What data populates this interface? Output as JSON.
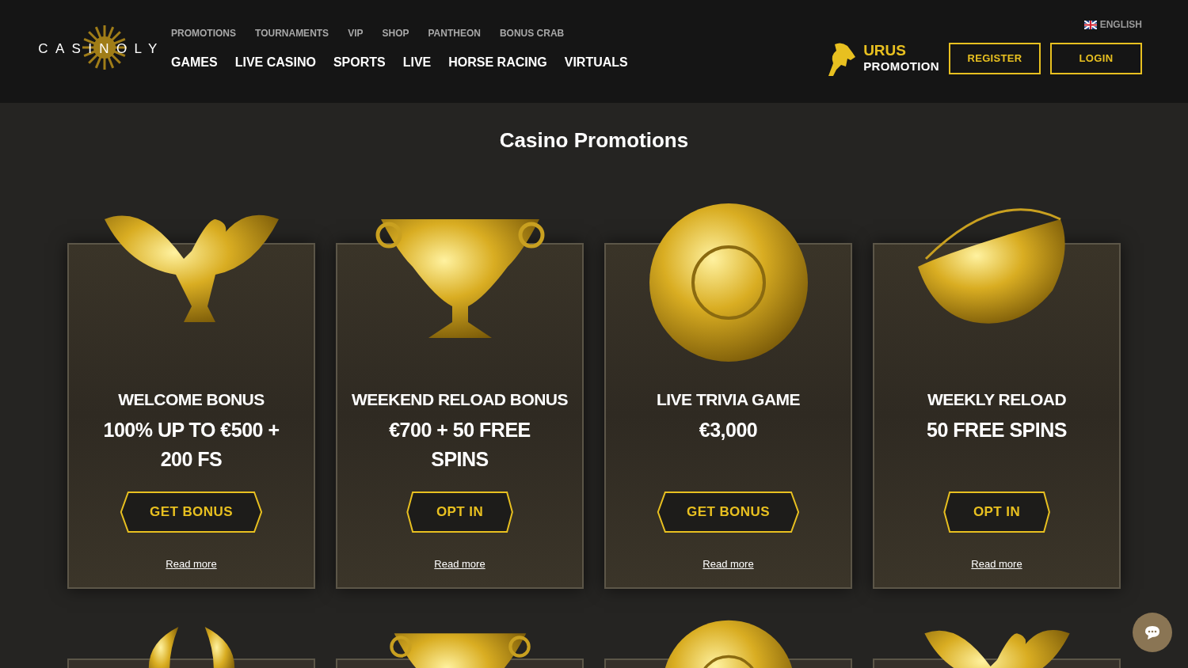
{
  "header": {
    "logo": "CASINOLY",
    "top_nav": [
      "PROMOTIONS",
      "TOURNAMENTS",
      "VIP",
      "SHOP",
      "PANTHEON",
      "BONUS CRAB"
    ],
    "main_nav": [
      "GAMES",
      "LIVE CASINO",
      "SPORTS",
      "LIVE",
      "HORSE RACING",
      "VIRTUALS"
    ],
    "language": "ENGLISH",
    "promo": {
      "title": "URUS",
      "subtitle": "PROMOTION"
    },
    "buttons": [
      "REGISTER",
      "LOGIN"
    ]
  },
  "page_title": "Casino Promotions",
  "promotions": [
    {
      "kind": "eagle",
      "title": "WELCOME BONUS",
      "offer": "100% UP TO €500 + 200 FS",
      "button": "GET BONUS",
      "link": "Read more"
    },
    {
      "kind": "cup",
      "title": "WEEKEND RELOAD BONUS",
      "offer": "€700 + 50 FREE SPINS",
      "button": "OPT IN",
      "link": "Read more"
    },
    {
      "kind": "shield",
      "title": "LIVE TRIVIA GAME",
      "offer": "€3,000",
      "button": "GET BONUS",
      "link": "Read more"
    },
    {
      "kind": "horn",
      "title": "WEEKLY RELOAD",
      "offer": "50 FREE SPINS",
      "button": "OPT IN",
      "link": "Read more"
    }
  ],
  "more_promotions": [
    {
      "kind": "wreath"
    },
    {
      "kind": "cup"
    },
    {
      "kind": "shield"
    },
    {
      "kind": "eagle"
    }
  ]
}
